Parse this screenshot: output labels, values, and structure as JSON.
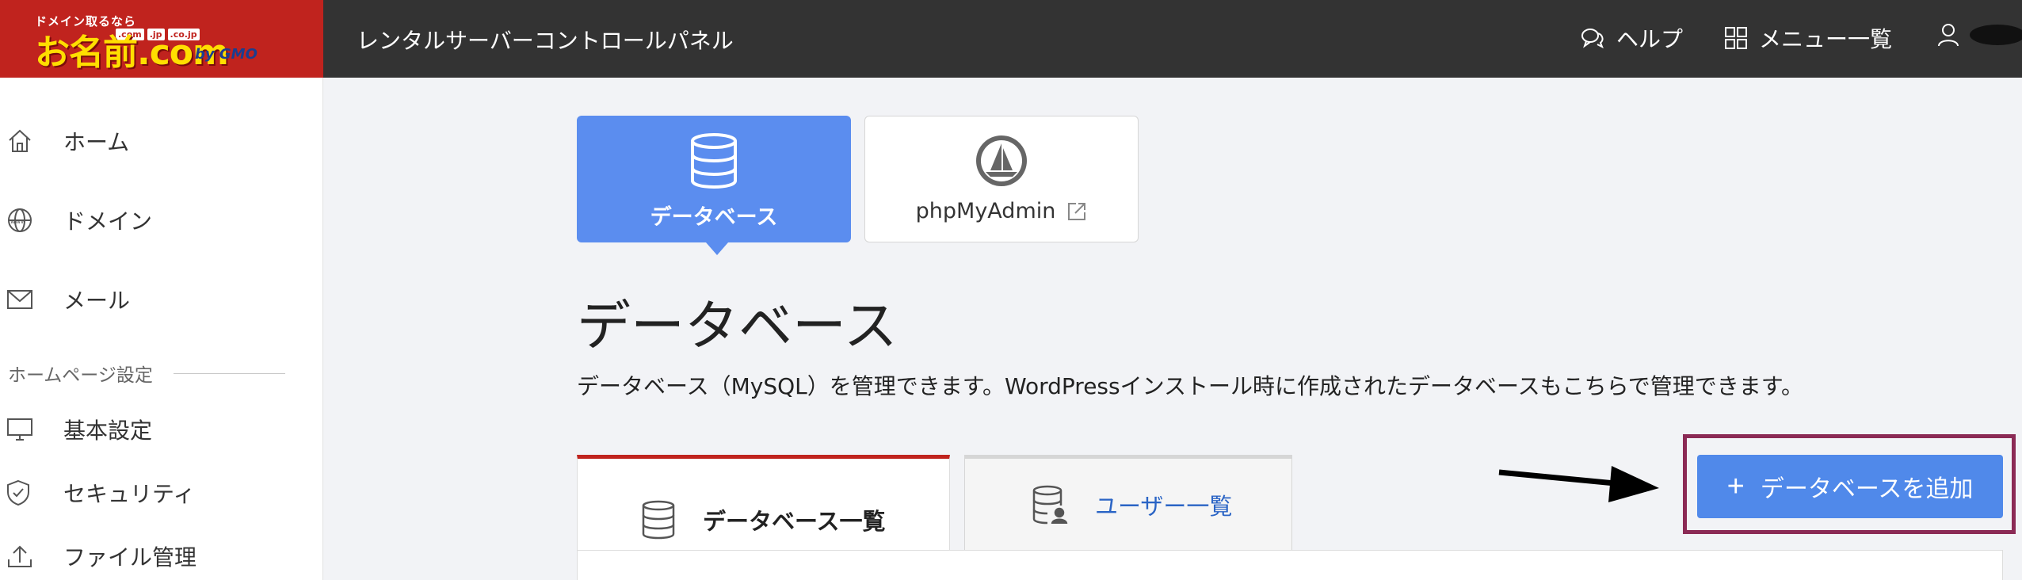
{
  "header": {
    "logo": {
      "tagline": "ドメイン取るなら",
      "domains": [
        ".com",
        ".jp",
        ".co.jp"
      ],
      "brand": "お名前.com",
      "by": "by GMO"
    },
    "title": "レンタルサーバーコントロールパネル",
    "nav": {
      "help": "ヘルプ",
      "menu": "メニュー一覧"
    }
  },
  "sidebar": {
    "items": [
      {
        "label": "ホーム",
        "icon": "home-icon"
      },
      {
        "label": "ドメイン",
        "icon": "globe-icon"
      },
      {
        "label": "メール",
        "icon": "mail-icon"
      }
    ],
    "section_label": "ホームページ設定",
    "section_items": [
      {
        "label": "基本設定",
        "icon": "monitor-icon"
      },
      {
        "label": "セキュリティ",
        "icon": "shield-icon"
      },
      {
        "label": "ファイル管理",
        "icon": "upload-icon"
      }
    ]
  },
  "tiles": {
    "database": "データベース",
    "phpmyadmin": "phpMyAdmin"
  },
  "main": {
    "title": "データベース",
    "description": "データベース（MySQL）を管理できます。WordPressインストール時に作成されたデータベースもこちらで管理できます。",
    "tabs": [
      {
        "label": "データベース一覧",
        "active": true
      },
      {
        "label": "ユーザー一覧",
        "active": false
      }
    ],
    "add_button": {
      "plus": "+",
      "label": "データベースを追加"
    }
  },
  "colors": {
    "header_bg": "#333333",
    "logo_bg": "#c0231e",
    "accent_blue": "#5089ea",
    "tab_active_border": "#c0231e",
    "highlight_box": "#8b2a55"
  }
}
